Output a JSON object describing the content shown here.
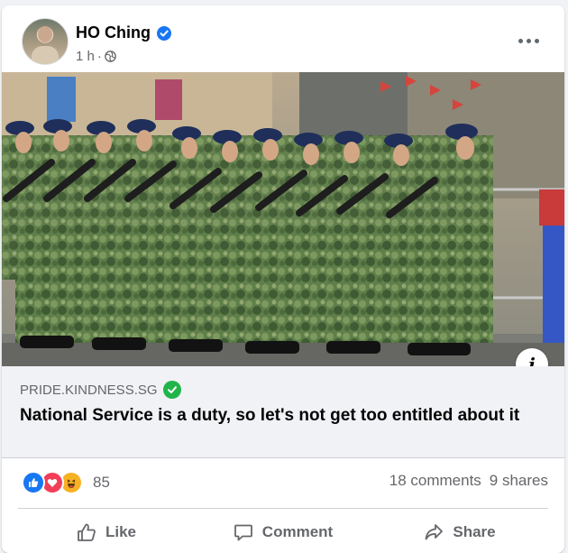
{
  "post": {
    "author": "HO Ching",
    "time": "1 h",
    "separator": "·"
  },
  "link": {
    "domain": "PRIDE.KINDNESS.SG",
    "headline": "National Service is a duty, so let's not get too entitled about it"
  },
  "engagement": {
    "reaction_count": "85",
    "comments": "18 comments",
    "shares": "9 shares"
  },
  "actions": {
    "like": "Like",
    "comment": "Comment",
    "share": "Share"
  },
  "colors": {
    "facebook_blue": "#1877f2",
    "love_red": "#f33e58",
    "haha_yellow": "#f7b125",
    "verified_green": "#21b44a"
  }
}
